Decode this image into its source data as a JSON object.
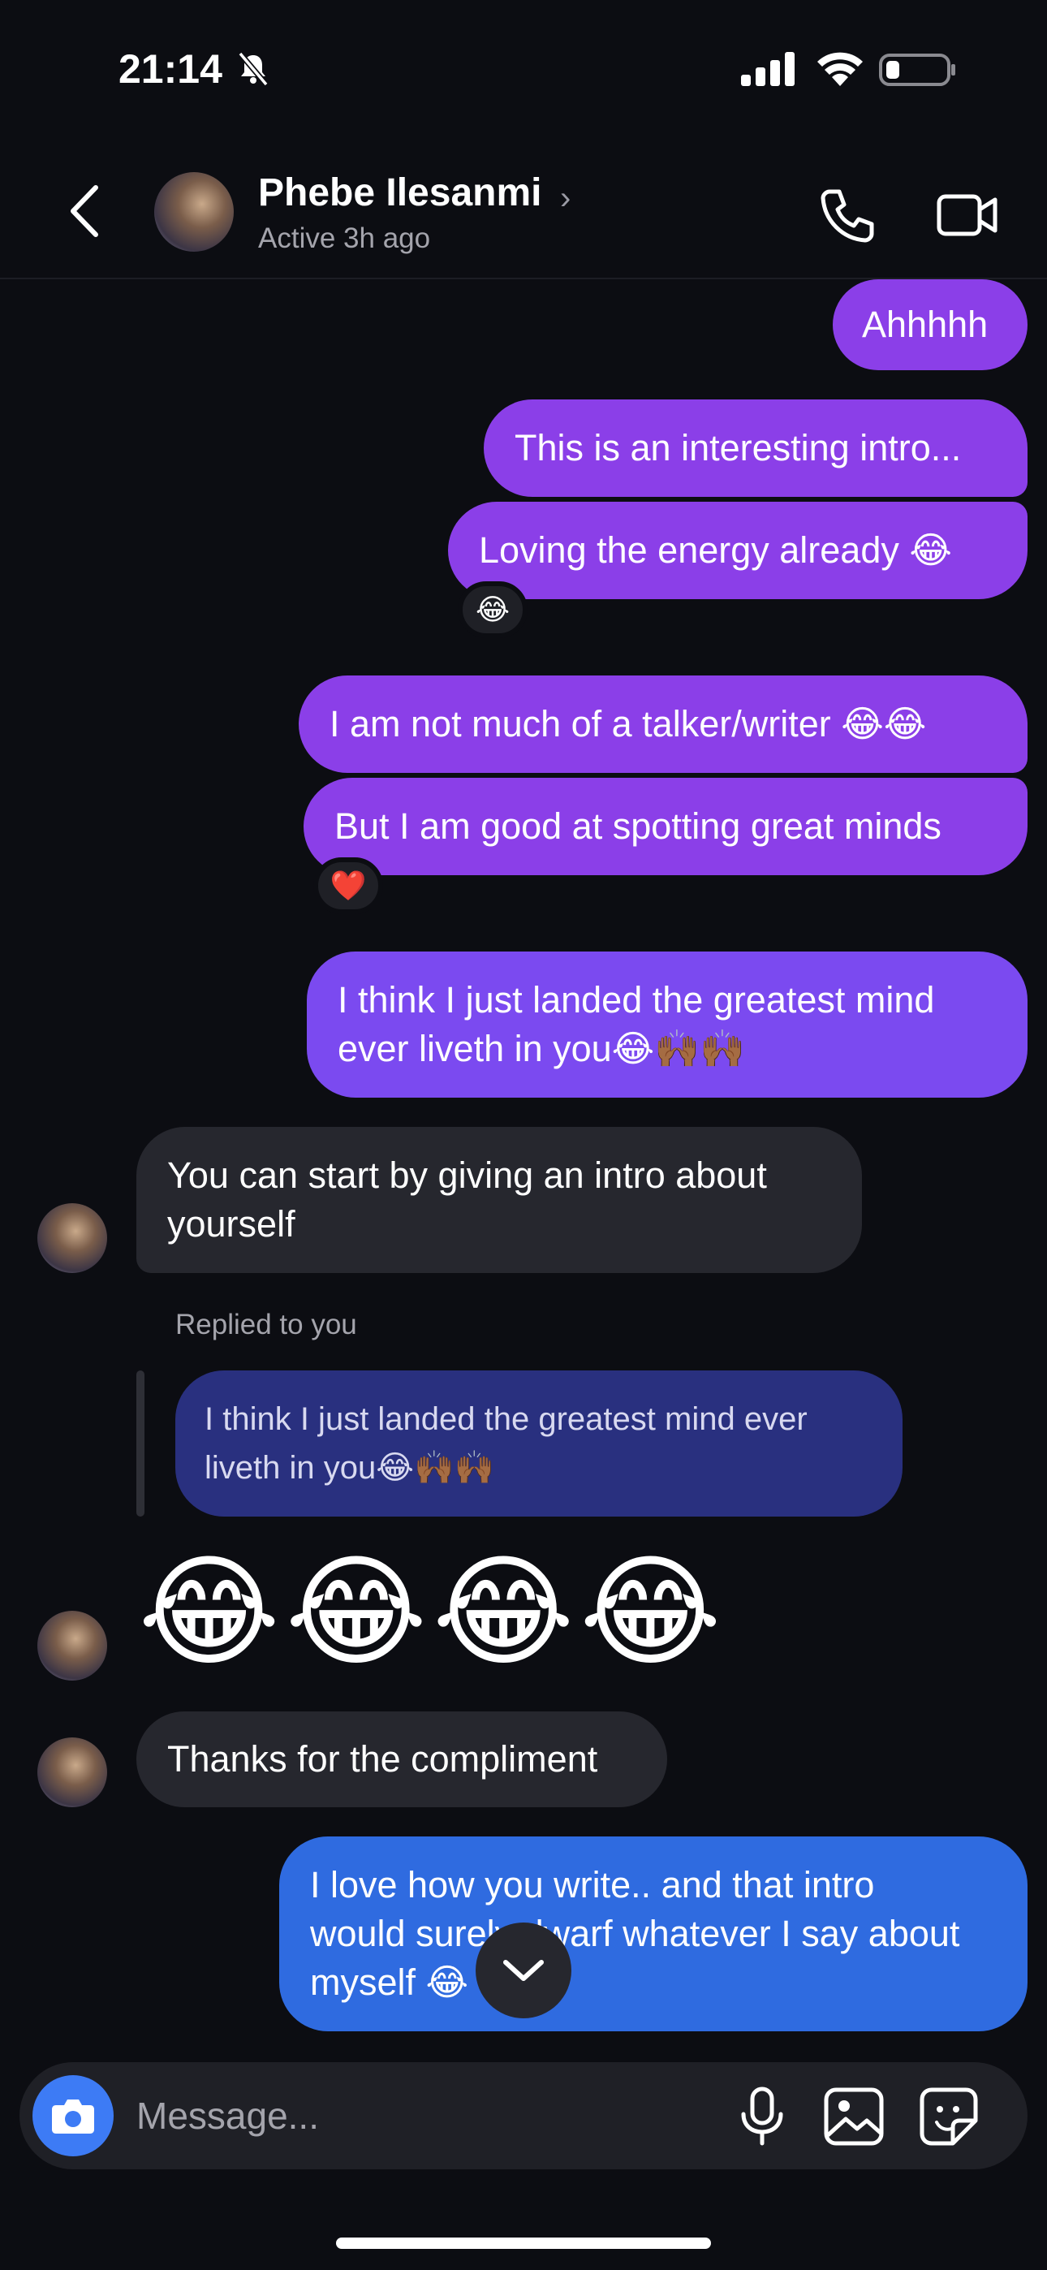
{
  "status_bar": {
    "time": "21:14",
    "icons": [
      "bell-slash-icon",
      "cellular-signal-icon",
      "wifi-icon",
      "battery-icon"
    ]
  },
  "header": {
    "contact_name": "Phebe Ilesanmi",
    "chevron": "›",
    "activity_status": "Active 3h ago",
    "icons": [
      "back-chevron-icon",
      "phone-icon",
      "video-camera-icon"
    ]
  },
  "messages": [
    {
      "direction": "outgoing",
      "text": "Ahhhhh"
    },
    {
      "direction": "outgoing",
      "text": "This is an interesting intro..."
    },
    {
      "direction": "outgoing",
      "text": "Loving the energy already 😂",
      "reaction": "😂"
    },
    {
      "direction": "outgoing",
      "text": "I am not much of a talker/writer 😂😂"
    },
    {
      "direction": "outgoing",
      "text": "But I am good at spotting great minds",
      "reaction": "❤️"
    },
    {
      "direction": "outgoing",
      "lines": [
        "I think I just landed the greatest mind",
        "ever liveth in you😂🙌🏾🙌🏾"
      ]
    },
    {
      "direction": "incoming",
      "lines": [
        "You can start by giving an intro about",
        "yourself"
      ]
    },
    {
      "direction": "incoming",
      "reply_label": "Replied to you",
      "quoted_lines": [
        "I think I just landed the greatest mind ever",
        "liveth in you😂🙌🏾🙌🏾"
      ],
      "text": "😂😂😂😂"
    },
    {
      "direction": "incoming",
      "text": "Thanks for the compliment"
    },
    {
      "direction": "outgoing",
      "lines": [
        "I love how you write.. and that intro",
        "would surely dwarf whatever I say about",
        "myself 😂"
      ]
    }
  ],
  "composer": {
    "placeholder": "Message...",
    "icons": [
      "camera-icon",
      "microphone-icon",
      "gallery-icon",
      "sticker-icon"
    ]
  },
  "colors": {
    "background": "#0c0d12",
    "outgoing_bubble": "#8b3fe8",
    "outgoing_bubble_blue": "#2f6be0",
    "incoming_bubble": "#26272e",
    "reply_bubble": "#29307f",
    "camera_button": "#3d7bf5"
  }
}
